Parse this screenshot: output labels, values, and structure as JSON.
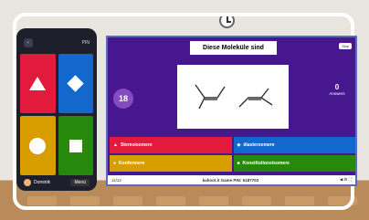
{
  "phone": {
    "back_label": "‹",
    "pin_label": "PIN",
    "player_name": "Dominik",
    "score_label": "Menü"
  },
  "host": {
    "question": "Diese Moleküle sind",
    "skip_label": "Skip",
    "timer": "18",
    "answers_count": "0",
    "answers_label": "Answers",
    "options": [
      {
        "icon": "triangle-icon",
        "label": "Stereoisomere"
      },
      {
        "icon": "diamond-icon",
        "label": "diastereomere"
      },
      {
        "icon": "circle-icon",
        "label": "Konformere"
      },
      {
        "icon": "square-icon",
        "label": "Konstitutionsisomere"
      }
    ],
    "bottom_bar": {
      "progress": "11/12",
      "center": "kahoot.it Game PIN: 5187703"
    }
  },
  "colors": {
    "red": "#e21b3c",
    "blue": "#1368ce",
    "yellow": "#d89e00",
    "green": "#26890c",
    "background": "#46178f"
  }
}
